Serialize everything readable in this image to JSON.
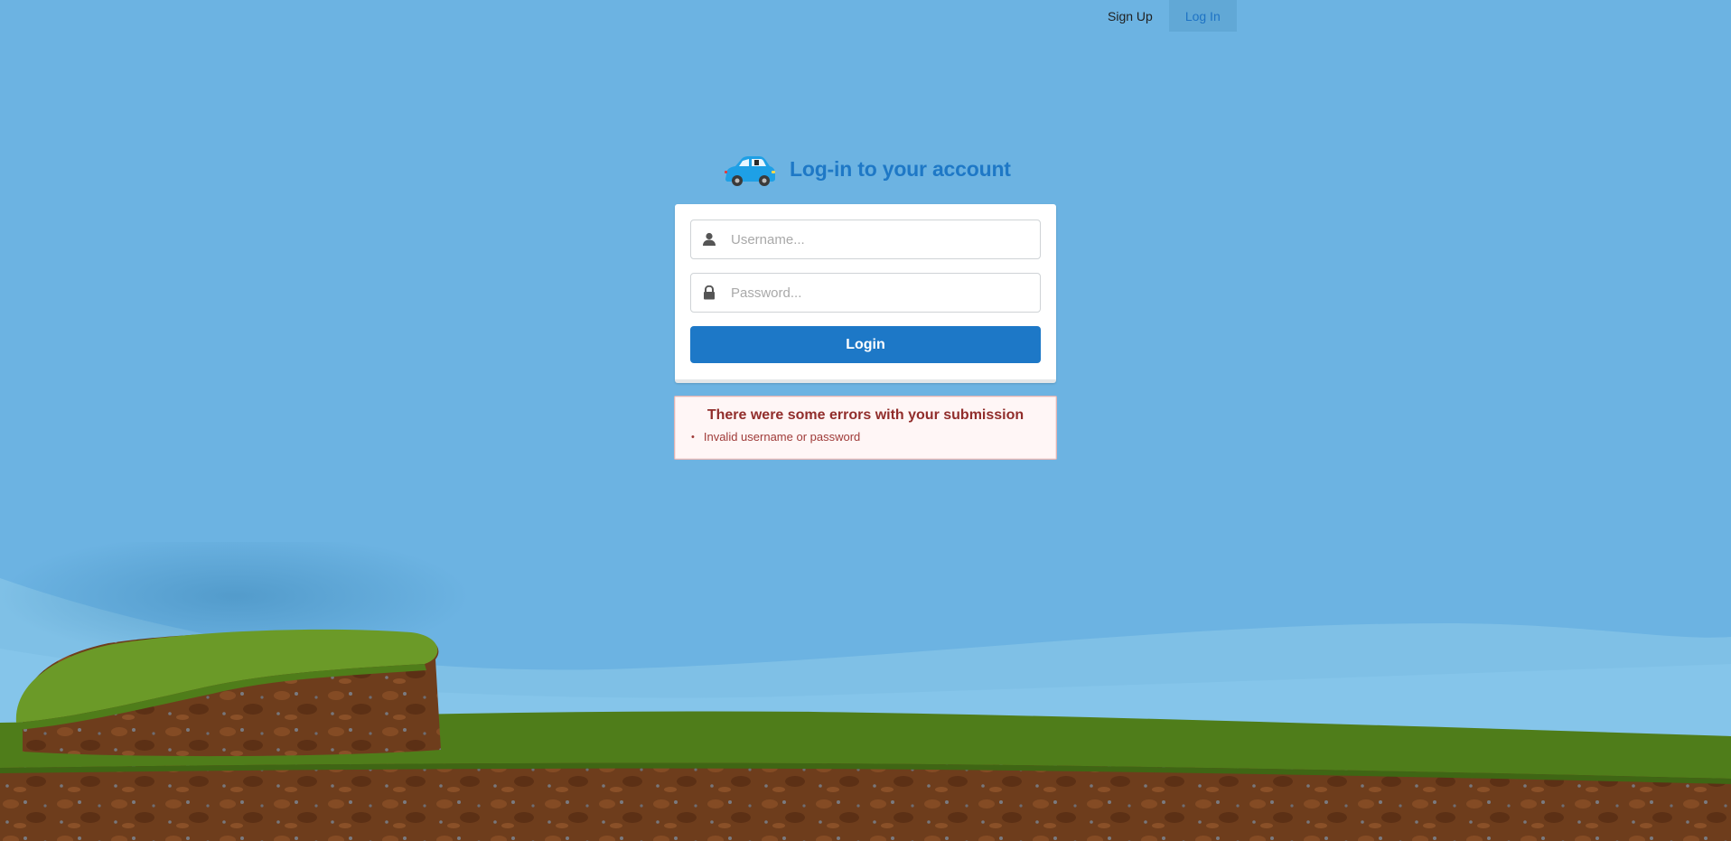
{
  "nav": {
    "sign_up": "Sign Up",
    "log_in": "Log In",
    "active": "Log In"
  },
  "header": {
    "icon": "car-icon",
    "title": "Log-in to your account"
  },
  "form": {
    "username": {
      "icon": "user-icon",
      "placeholder": "Username...",
      "value": ""
    },
    "password": {
      "icon": "lock-icon",
      "placeholder": "Password...",
      "value": ""
    },
    "submit_label": "Login"
  },
  "error": {
    "title": "There were some errors with your submission",
    "items": [
      "Invalid username or password"
    ]
  },
  "colors": {
    "sky": "#6cb3e2",
    "primary": "#1d78c7",
    "error_text": "#912d2b",
    "error_bg": "#fff6f6",
    "grass": "#5a8a1f",
    "dirt": "#6b3a1c"
  }
}
